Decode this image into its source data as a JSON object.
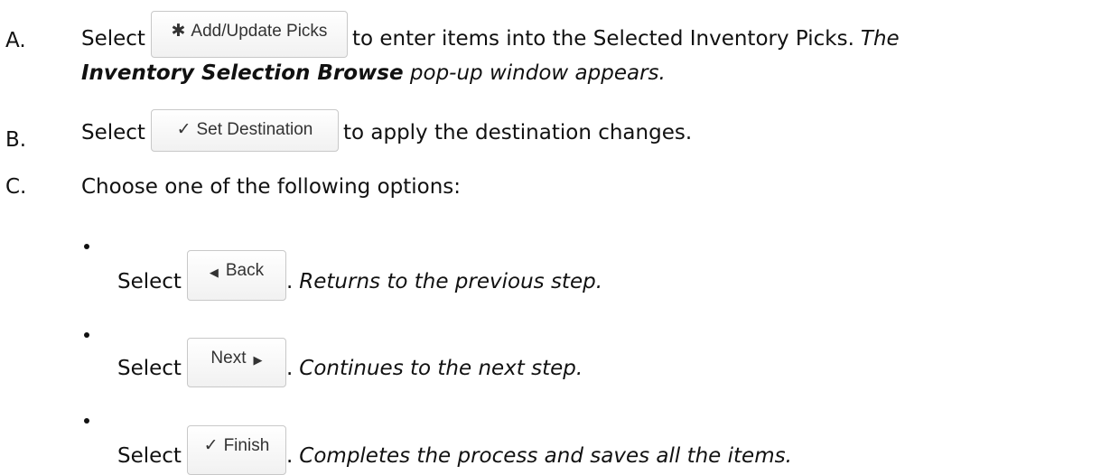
{
  "steps": {
    "a": {
      "letter": "A.",
      "before": "Select",
      "button_label": "Add/Update Picks",
      "button_icon": "gear-icon",
      "after": "to enter items into the Selected Inventory Picks.",
      "italic_lead": "The",
      "bold_italic": "Inventory Selection Browse",
      "italic_tail": "pop-up window appears."
    },
    "b": {
      "letter": "B.",
      "before": "Select",
      "button_label": "Set Destination",
      "button_icon": "checkmark-icon",
      "after": "to apply the destination changes."
    },
    "c": {
      "letter": "C.",
      "text": "Choose one of the following options:"
    }
  },
  "options": [
    {
      "before": "Select",
      "button_label": "Back",
      "button_icon": "triangle-left-icon",
      "sep": ".",
      "result": "Returns to the previous step."
    },
    {
      "before": "Select",
      "button_label": "Next",
      "button_icon": "triangle-right-icon",
      "sep": ".",
      "result": "Continues to the next step."
    },
    {
      "before": "Select",
      "button_label": "Finish",
      "button_icon": "checkmark-icon",
      "sep": ".",
      "result": "Completes the process and saves all the items."
    }
  ]
}
